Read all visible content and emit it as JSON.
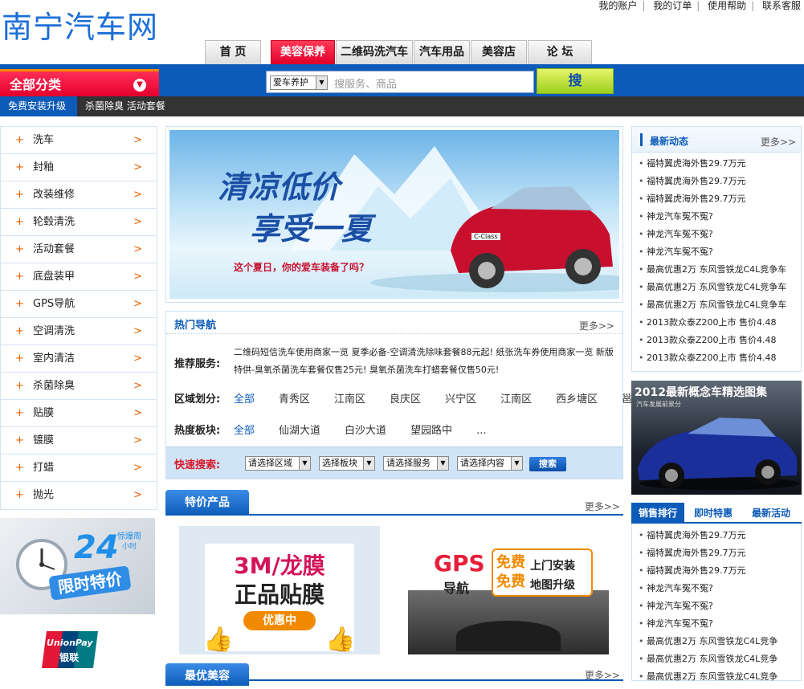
{
  "site": {
    "logo": "南宁汽车网"
  },
  "top_links": [
    "我的账户",
    "我的订单",
    "使用帮助",
    "联系客服"
  ],
  "nav_tabs": [
    {
      "label": "首 页",
      "active": false
    },
    {
      "label": "美容保养",
      "active": true
    },
    {
      "label": "二维码洗汽车",
      "active": false
    },
    {
      "label": "汽车用品",
      "active": false
    },
    {
      "label": "美容店",
      "active": false
    },
    {
      "label": "论 坛",
      "active": false
    }
  ],
  "all_categories": "全部分类",
  "search": {
    "select_value": "爱车养护",
    "placeholder": "搜服务、商品",
    "button": "搜 索"
  },
  "subnav": [
    "免费安装升级",
    "杀菌除臭 活动套餐"
  ],
  "categories": [
    "洗车",
    "封釉",
    "改装维修",
    "轮毂清洗",
    "活动套餐",
    "底盘装甲",
    "GPS导航",
    "空调清洗",
    "室内清洁",
    "杀菌除臭",
    "贴膜",
    "镀膜",
    "打蜡",
    "抛光"
  ],
  "ads": {
    "ad24_number": "24",
    "ad24_small": "惊爆周",
    "ad24_small2": "小时",
    "ad24_text": "限时特价",
    "unionpay_en": "UnionPay",
    "unionpay_cn": "银联"
  },
  "banner": {
    "headline1": "清凉低价",
    "headline2": "享受一夏",
    "sub": "这个夏日，你的爱车装备了吗？",
    "plate": "C-Class"
  },
  "hot_nav": {
    "title": "热门导航",
    "more": "更多>>",
    "recommend_label": "推荐服务:",
    "recommend_text": "二维码短信洗车使用商家一览  夏季必备-空调清洗除味套餐88元起!  纸张洗车券使用商家一览  新版特供-臭氧杀菌洗车套餐仅售25元!  臭氧杀菌洗车打蜡套餐仅售50元!",
    "region_label": "区域划分:",
    "regions": [
      "全部",
      "青秀区",
      "江南区",
      "良庆区",
      "兴宁区",
      "江南区",
      "西乡塘区",
      "邕宁区"
    ],
    "hot_label": "热度板块:",
    "hot_blocks": [
      "全部",
      "仙湖大道",
      "白沙大道",
      "望园路中",
      "..."
    ]
  },
  "quick_search": {
    "label": "快速搜索:",
    "selects": [
      "请选择区域",
      "选择板块",
      "请选择服务",
      "请选择内容"
    ],
    "button": "搜索"
  },
  "special": {
    "title": "特价产品",
    "more": "更多>>"
  },
  "best": {
    "title": "最优美容",
    "more": "更多>>"
  },
  "products": {
    "p1_line1": "3M/龙膜",
    "p1_line2": "正品贴膜",
    "p1_badge": "优惠中",
    "p2_gps": "GPS",
    "p2_nav": "导航",
    "p2_free": "免费",
    "p2_line1": "上门安装",
    "p2_line2": "地图升级"
  },
  "news": {
    "title": "最新动态",
    "more": "更多>>",
    "items": [
      "福特翼虎海外售29.7万元",
      "福特翼虎海外售29.7万元",
      "福特翼虎海外售29.7万元",
      "神龙汽车冤不冤?",
      "神龙汽车冤不冤?",
      "神龙汽车冤不冤?",
      "最高优惠2万 东风雪铁龙C4L竞争车",
      "最高优惠2万 东风雪铁龙C4L竞争车",
      "最高优惠2万 东风雪铁龙C4L竞争车",
      "2013款众泰Z200上市 售价4.48",
      "2013款众泰Z200上市 售价4.48",
      "2013款众泰Z200上市 售价4.48"
    ]
  },
  "concept_ad": {
    "title": "2012最新概念车精选图集",
    "sub": "汽车发展前景分"
  },
  "sales_tabs": [
    "销售排行",
    "即时特惠",
    "最新活动"
  ],
  "sales_items": [
    "福特翼虎海外售29.7万元",
    "福特翼虎海外售29.7万元",
    "福特翼虎海外售29.7万元",
    "神龙汽车冤不冤?",
    "神龙汽车冤不冤?",
    "神龙汽车冤不冤?",
    "最高优惠2万 东风雪铁龙C4L竞争",
    "最高优惠2万 东风雪铁龙C4L竞争",
    "最高优惠2万 东风雪铁龙C4L竞争"
  ],
  "colors": {
    "brand_blue": "#0c5bb8",
    "accent_red": "#e4002c",
    "orange": "#e86000",
    "logo_blue": "#1d6fd6"
  }
}
